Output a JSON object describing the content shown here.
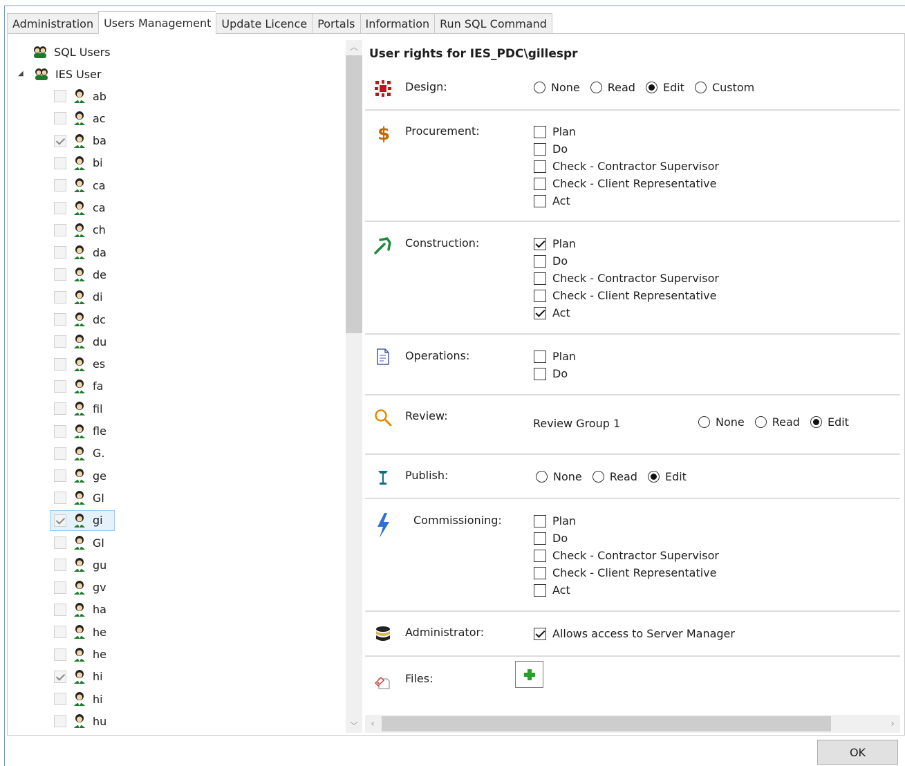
{
  "tabs": [
    {
      "label": "Administration",
      "active": false
    },
    {
      "label": "Users Management",
      "active": true
    },
    {
      "label": "Update Licence",
      "active": false
    },
    {
      "label": "Portals",
      "active": false
    },
    {
      "label": "Information",
      "active": false
    },
    {
      "label": "Run SQL Command",
      "active": false
    }
  ],
  "tree": {
    "sql_users_label": "SQL Users",
    "ies_user_label": "IES User",
    "users": [
      {
        "name": "ab",
        "checked": false
      },
      {
        "name": "ac",
        "checked": false
      },
      {
        "name": "ba",
        "checked": true
      },
      {
        "name": "bi",
        "checked": false
      },
      {
        "name": "ca",
        "checked": false
      },
      {
        "name": "ca",
        "checked": false
      },
      {
        "name": "ch",
        "checked": false
      },
      {
        "name": "da",
        "checked": false
      },
      {
        "name": "de",
        "checked": false
      },
      {
        "name": "di",
        "checked": false
      },
      {
        "name": "dc",
        "checked": false
      },
      {
        "name": "du",
        "checked": false
      },
      {
        "name": "es",
        "checked": false
      },
      {
        "name": "fa",
        "checked": false
      },
      {
        "name": "fil",
        "checked": false
      },
      {
        "name": "fle",
        "checked": false
      },
      {
        "name": "G.",
        "checked": false
      },
      {
        "name": "ge",
        "checked": false
      },
      {
        "name": "Gl",
        "checked": false
      },
      {
        "name": "gi",
        "checked": true,
        "selected": true
      },
      {
        "name": "Gl",
        "checked": false
      },
      {
        "name": "gu",
        "checked": false
      },
      {
        "name": "gv",
        "checked": false
      },
      {
        "name": "ha",
        "checked": false
      },
      {
        "name": "he",
        "checked": false
      },
      {
        "name": "he",
        "checked": false
      },
      {
        "name": "hi",
        "checked": true
      },
      {
        "name": "hi",
        "checked": false
      },
      {
        "name": "hu",
        "checked": false
      }
    ]
  },
  "rights": {
    "title": "User rights for IES_PDC\\gillespr",
    "design": {
      "label": "Design:",
      "options": [
        "None",
        "Read",
        "Edit",
        "Custom"
      ],
      "selected": "Edit"
    },
    "procurement": {
      "label": "Procurement:",
      "options": [
        {
          "label": "Plan",
          "checked": false
        },
        {
          "label": "Do",
          "checked": false
        },
        {
          "label": "Check - Contractor Supervisor",
          "checked": false
        },
        {
          "label": "Check - Client Representative",
          "checked": false
        },
        {
          "label": "Act",
          "checked": false
        }
      ]
    },
    "construction": {
      "label": "Construction:",
      "options": [
        {
          "label": "Plan",
          "checked": true
        },
        {
          "label": "Do",
          "checked": false
        },
        {
          "label": "Check - Contractor Supervisor",
          "checked": false
        },
        {
          "label": "Check - Client Representative",
          "checked": false
        },
        {
          "label": "Act",
          "checked": true
        }
      ]
    },
    "operations": {
      "label": "Operations:",
      "options": [
        {
          "label": "Plan",
          "checked": false
        },
        {
          "label": "Do",
          "checked": false
        }
      ]
    },
    "review": {
      "label": "Review:",
      "group": "Review Group 1",
      "options": [
        "None",
        "Read",
        "Edit"
      ],
      "selected": "Edit"
    },
    "publish": {
      "label": "Publish:",
      "options": [
        "None",
        "Read",
        "Edit"
      ],
      "selected": "Edit"
    },
    "commissioning": {
      "label": "Commissioning:",
      "options": [
        {
          "label": "Plan",
          "checked": false
        },
        {
          "label": "Do",
          "checked": false
        },
        {
          "label": "Check - Contractor Supervisor",
          "checked": false
        },
        {
          "label": "Check - Client Representative",
          "checked": false
        },
        {
          "label": "Act",
          "checked": false
        }
      ]
    },
    "administrator": {
      "label": "Administrator:",
      "option": "Allows access to Server Manager",
      "checked": true
    },
    "files": {
      "label": "Files:"
    }
  },
  "ok_label": "OK",
  "colors": {
    "design_icon": "#c0141c",
    "procurement_icon": "#c06a00",
    "construction_icon": "#1e8a3c",
    "commissioning_icon": "#2f6fd8",
    "review_icon": "#e38a00",
    "publish_icon": "#0f6e86",
    "add_icon": "#2aa02a"
  }
}
